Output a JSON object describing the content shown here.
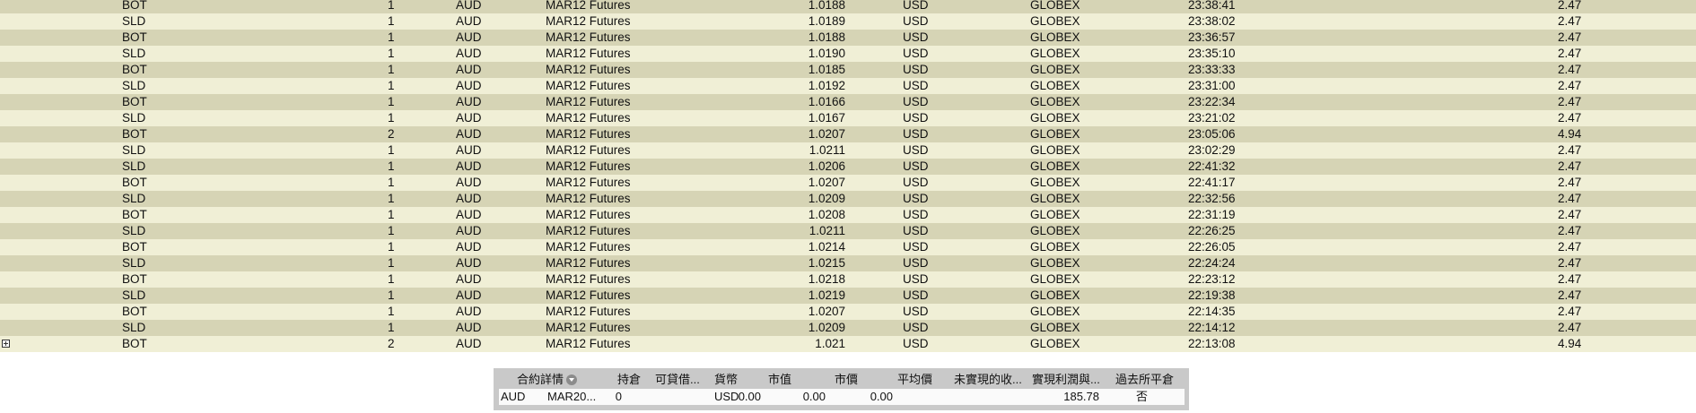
{
  "trades_table": {
    "rows": [
      {
        "action": "BOT",
        "quantity": "1",
        "symbol": "AUD",
        "description": "MAR12 Futures",
        "price": "1.0188",
        "currency": "USD",
        "exchange": "GLOBEX",
        "time": "23:38:41",
        "commission": "2.47"
      },
      {
        "action": "SLD",
        "quantity": "1",
        "symbol": "AUD",
        "description": "MAR12 Futures",
        "price": "1.0189",
        "currency": "USD",
        "exchange": "GLOBEX",
        "time": "23:38:02",
        "commission": "2.47"
      },
      {
        "action": "BOT",
        "quantity": "1",
        "symbol": "AUD",
        "description": "MAR12 Futures",
        "price": "1.0188",
        "currency": "USD",
        "exchange": "GLOBEX",
        "time": "23:36:57",
        "commission": "2.47"
      },
      {
        "action": "SLD",
        "quantity": "1",
        "symbol": "AUD",
        "description": "MAR12 Futures",
        "price": "1.0190",
        "currency": "USD",
        "exchange": "GLOBEX",
        "time": "23:35:10",
        "commission": "2.47"
      },
      {
        "action": "BOT",
        "quantity": "1",
        "symbol": "AUD",
        "description": "MAR12 Futures",
        "price": "1.0185",
        "currency": "USD",
        "exchange": "GLOBEX",
        "time": "23:33:33",
        "commission": "2.47"
      },
      {
        "action": "SLD",
        "quantity": "1",
        "symbol": "AUD",
        "description": "MAR12 Futures",
        "price": "1.0192",
        "currency": "USD",
        "exchange": "GLOBEX",
        "time": "23:31:00",
        "commission": "2.47"
      },
      {
        "action": "BOT",
        "quantity": "1",
        "symbol": "AUD",
        "description": "MAR12 Futures",
        "price": "1.0166",
        "currency": "USD",
        "exchange": "GLOBEX",
        "time": "23:22:34",
        "commission": "2.47"
      },
      {
        "action": "SLD",
        "quantity": "1",
        "symbol": "AUD",
        "description": "MAR12 Futures",
        "price": "1.0167",
        "currency": "USD",
        "exchange": "GLOBEX",
        "time": "23:21:02",
        "commission": "2.47"
      },
      {
        "action": "BOT",
        "quantity": "2",
        "symbol": "AUD",
        "description": "MAR12 Futures",
        "price": "1.0207",
        "currency": "USD",
        "exchange": "GLOBEX",
        "time": "23:05:06",
        "commission": "4.94"
      },
      {
        "action": "SLD",
        "quantity": "1",
        "symbol": "AUD",
        "description": "MAR12 Futures",
        "price": "1.0211",
        "currency": "USD",
        "exchange": "GLOBEX",
        "time": "23:02:29",
        "commission": "2.47"
      },
      {
        "action": "SLD",
        "quantity": "1",
        "symbol": "AUD",
        "description": "MAR12 Futures",
        "price": "1.0206",
        "currency": "USD",
        "exchange": "GLOBEX",
        "time": "22:41:32",
        "commission": "2.47"
      },
      {
        "action": "BOT",
        "quantity": "1",
        "symbol": "AUD",
        "description": "MAR12 Futures",
        "price": "1.0207",
        "currency": "USD",
        "exchange": "GLOBEX",
        "time": "22:41:17",
        "commission": "2.47"
      },
      {
        "action": "SLD",
        "quantity": "1",
        "symbol": "AUD",
        "description": "MAR12 Futures",
        "price": "1.0209",
        "currency": "USD",
        "exchange": "GLOBEX",
        "time": "22:32:56",
        "commission": "2.47"
      },
      {
        "action": "BOT",
        "quantity": "1",
        "symbol": "AUD",
        "description": "MAR12 Futures",
        "price": "1.0208",
        "currency": "USD",
        "exchange": "GLOBEX",
        "time": "22:31:19",
        "commission": "2.47"
      },
      {
        "action": "SLD",
        "quantity": "1",
        "symbol": "AUD",
        "description": "MAR12 Futures",
        "price": "1.0211",
        "currency": "USD",
        "exchange": "GLOBEX",
        "time": "22:26:25",
        "commission": "2.47"
      },
      {
        "action": "BOT",
        "quantity": "1",
        "symbol": "AUD",
        "description": "MAR12 Futures",
        "price": "1.0214",
        "currency": "USD",
        "exchange": "GLOBEX",
        "time": "22:26:05",
        "commission": "2.47"
      },
      {
        "action": "SLD",
        "quantity": "1",
        "symbol": "AUD",
        "description": "MAR12 Futures",
        "price": "1.0215",
        "currency": "USD",
        "exchange": "GLOBEX",
        "time": "22:24:24",
        "commission": "2.47"
      },
      {
        "action": "BOT",
        "quantity": "1",
        "symbol": "AUD",
        "description": "MAR12 Futures",
        "price": "1.0218",
        "currency": "USD",
        "exchange": "GLOBEX",
        "time": "22:23:12",
        "commission": "2.47"
      },
      {
        "action": "SLD",
        "quantity": "1",
        "symbol": "AUD",
        "description": "MAR12 Futures",
        "price": "1.0219",
        "currency": "USD",
        "exchange": "GLOBEX",
        "time": "22:19:38",
        "commission": "2.47"
      },
      {
        "action": "BOT",
        "quantity": "1",
        "symbol": "AUD",
        "description": "MAR12 Futures",
        "price": "1.0207",
        "currency": "USD",
        "exchange": "GLOBEX",
        "time": "22:14:35",
        "commission": "2.47"
      },
      {
        "action": "SLD",
        "quantity": "1",
        "symbol": "AUD",
        "description": "MAR12 Futures",
        "price": "1.0209",
        "currency": "USD",
        "exchange": "GLOBEX",
        "time": "22:14:12",
        "commission": "2.47"
      },
      {
        "action": "BOT",
        "quantity": "2",
        "symbol": "AUD",
        "description": "MAR12 Futures",
        "price": "1.021",
        "currency": "USD",
        "exchange": "GLOBEX",
        "time": "22:13:08",
        "commission": "4.94",
        "expandable": true
      }
    ]
  },
  "portfolio": {
    "headers": {
      "contract": "合約詳情",
      "position": "持倉",
      "available": "可貸借...",
      "currency": "貨幣",
      "market_value": "市值",
      "market_price": "市價",
      "avg_price": "平均價",
      "unrealized": "未實現的收...",
      "realized": "實現利潤與...",
      "exchange_close": "過去所平倉"
    },
    "row": {
      "symbol": "AUD",
      "contract": "MAR20...",
      "position": "0",
      "currency": "USD",
      "market_value": "0.00",
      "market_price": "0.00",
      "avg_price": "0.00",
      "realized": "185.78",
      "exchange_close": "否"
    },
    "icons": {
      "sort": "sort-dropdown-icon",
      "expand": "expand-plus-icon"
    }
  },
  "colors": {
    "row_odd": "#d6d4b5",
    "row_even": "#f0efd6",
    "panel": "#c9c9c9"
  }
}
